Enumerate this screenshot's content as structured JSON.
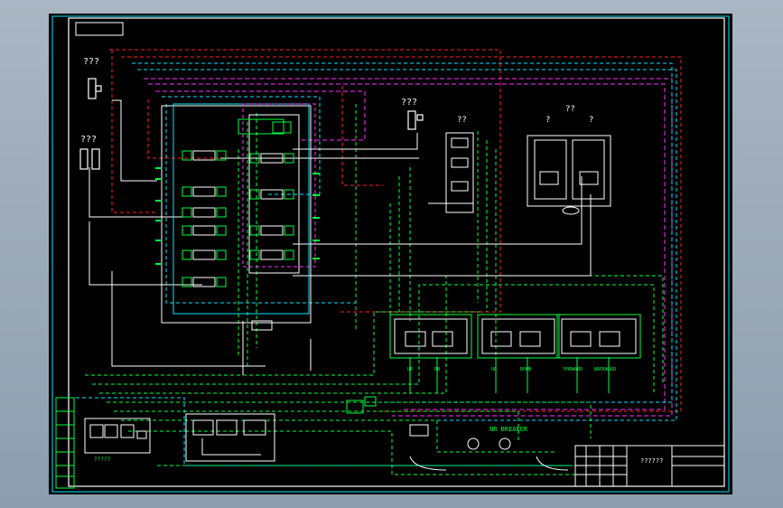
{
  "drawing": {
    "top_left_labels": [
      "???",
      "???"
    ],
    "mid_label": "???",
    "group_labels": [
      "??",
      "??",
      "?",
      "?"
    ],
    "bottom_labels": {
      "breaker": "NR BREAKER",
      "block_caption": "?????",
      "title_block_text": "??????"
    },
    "valve_groups": [
      {
        "ports": [
          "UP",
          "DN"
        ]
      },
      {
        "ports": [
          "UP",
          "DOWN"
        ]
      },
      {
        "ports": [
          "FORWARD",
          "BACKWARD"
        ]
      }
    ],
    "colors": {
      "background": "#000000",
      "border": "#ffffff",
      "frame": "#00e5ff",
      "hydraulic_main": "#00ff40",
      "pilot": "#00e5ff",
      "drain": "#ff2020",
      "signal": "#ff30ff",
      "text": "#00ff40"
    }
  }
}
